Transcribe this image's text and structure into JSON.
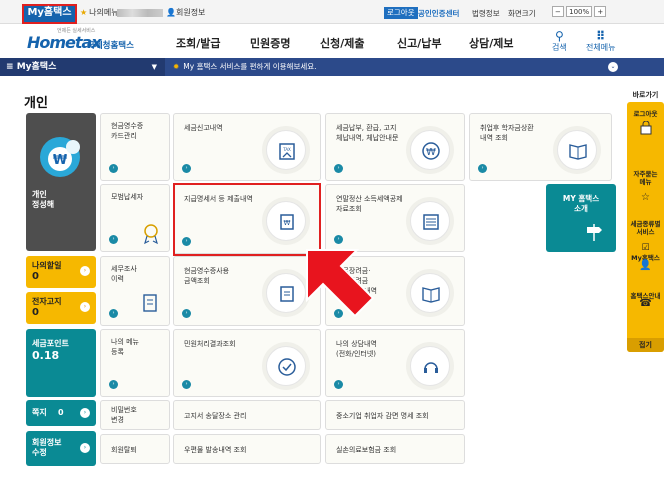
{
  "topbar": {
    "my_hometax": "My홈택스",
    "my_menu": "나의메뉴",
    "account_info": "회원정보",
    "login": "로그아웃",
    "certificate_center": "공인인증센터",
    "law": "법령정보",
    "screen_size": "화면크기",
    "zoom": "100%"
  },
  "header": {
    "logo_main": "Hometax",
    "logo_sub": "국세청홈택스",
    "logo_tagline": "언제든 실세서비스",
    "menu": [
      "조회/발급",
      "민원증명",
      "신청/제출",
      "신고/납부",
      "상담/제보"
    ],
    "search": "검색",
    "all_menu": "전체메뉴"
  },
  "nav": {
    "my_hometax": "My홈택스",
    "message": "My 홈택스 서비스를 편하게 이용해보세요."
  },
  "page": {
    "title": "개인"
  },
  "left_panel": {
    "profile_label": "개인",
    "profile_name": "정성해",
    "rows": [
      {
        "label": "나의할일",
        "value": "0"
      },
      {
        "label": "전자고지",
        "value": "0"
      },
      {
        "label": "세금포인트",
        "value": "0.18"
      },
      {
        "label": "쪽지",
        "value": "0"
      },
      {
        "label": "회원정보\n수정",
        "value": ""
      }
    ]
  },
  "tiles": {
    "cash_receipt": "현금영수증\n카드관리",
    "tax_report": "세금신고내역",
    "tax_payment": "세금납부, 환급, 고지\n체납내역, 체납안내문",
    "student_loan": "취업후 학자금상환\n내역 조회",
    "model_taxpayer": "모범납세자",
    "payment_statement": "지급명세서 등 제출내역",
    "year_end": "연말정산 소득세액공제\n자료조회",
    "my_hometax_intro": "MY 홈택스\n소개",
    "tax_audit": "세무조사\n이력",
    "cash_receipt_usage": "현금영수증사용\n금액조회",
    "earned_income": "근로장려금·\n자녀장려금\n신청/결정내역",
    "my_menu_reg": "나의 메뉴\n등록",
    "civil_complaint": "민원처리결과조회",
    "my_consult": "나의 상담내역\n(전화/인터넷)",
    "password_change": "비밀번호\n변경",
    "notice_place": "고지서 송달장소 관리",
    "sme_tax": "중소기업 취업자 감면 명세 조회",
    "withdraw": "회원탈퇴",
    "mail_history": "우편물 발송내역 조회",
    "medical_insurance": "실손의료보험금 조회"
  },
  "quick_menu": {
    "header": "바로가기",
    "items": [
      "로그아웃",
      "자주묻는\n메뉴",
      "세금종류별\n서비스",
      "My홈택스",
      "홈택스안내"
    ],
    "fold": "접기"
  },
  "colors": {
    "brand_blue": "#1563ad",
    "nav_dark_blue": "#2c4a8a",
    "yellow": "#f6b800",
    "teal": "#0a8a94",
    "highlight_red": "#e02020"
  }
}
